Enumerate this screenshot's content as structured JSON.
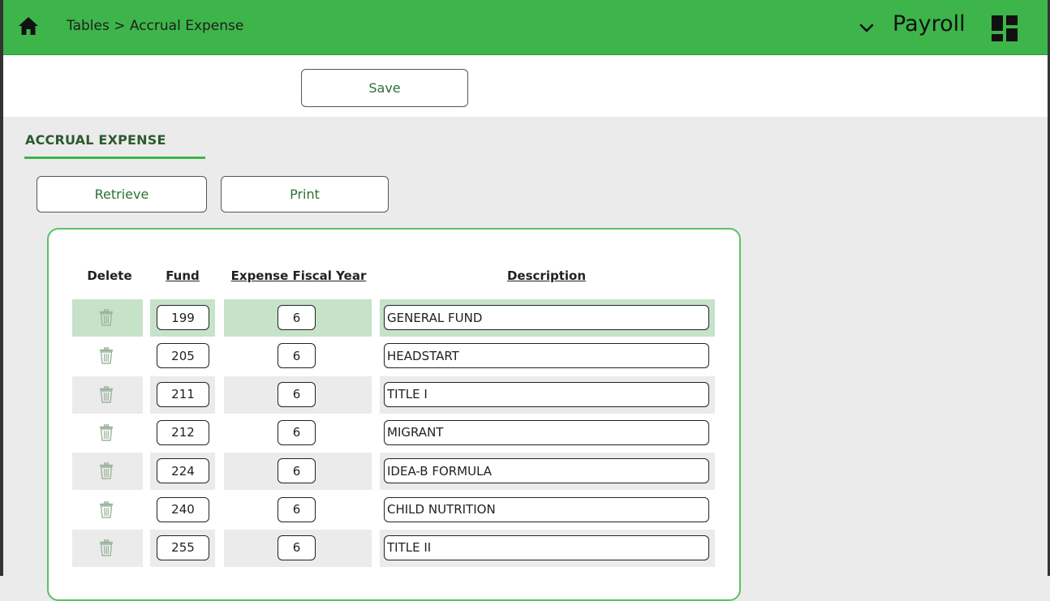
{
  "header": {
    "breadcrumb": "Tables > Accrual Expense",
    "module": "Payroll",
    "bar_color": "#3db54a"
  },
  "toolbar": {
    "save_label": "Save"
  },
  "section": {
    "tab_label": "ACCRUAL EXPENSE",
    "retrieve_label": "Retrieve",
    "print_label": "Print"
  },
  "table": {
    "columns": [
      "Delete",
      "Fund",
      "Expense Fiscal Year",
      "Description"
    ],
    "rows": [
      {
        "fund": "199",
        "year": "6",
        "description": "GENERAL FUND",
        "selected": true
      },
      {
        "fund": "205",
        "year": "6",
        "description": "HEADSTART",
        "selected": false
      },
      {
        "fund": "211",
        "year": "6",
        "description": "TITLE I",
        "selected": false
      },
      {
        "fund": "212",
        "year": "6",
        "description": "MIGRANT",
        "selected": false
      },
      {
        "fund": "224",
        "year": "6",
        "description": "IDEA-B FORMULA",
        "selected": false
      },
      {
        "fund": "240",
        "year": "6",
        "description": "CHILD NUTRITION",
        "selected": false
      },
      {
        "fund": "255",
        "year": "6",
        "description": "TITLE II",
        "selected": false
      }
    ]
  },
  "icons": {
    "home": "home-icon",
    "module_menu": "chevron-down-icon",
    "apps": "grid-icon",
    "delete": "trash-icon"
  }
}
